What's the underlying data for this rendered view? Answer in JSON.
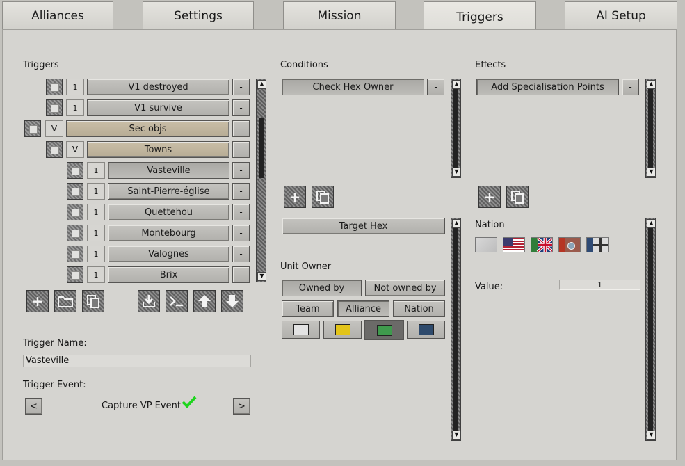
{
  "tabs": [
    "Alliances",
    "Settings",
    "Mission",
    "Triggers",
    "AI Setup"
  ],
  "triggers": {
    "header": "Triggers",
    "rows": [
      {
        "num": "1",
        "label": "V1 destroyed"
      },
      {
        "num": "1",
        "label": "V1 survive"
      },
      {
        "num": "V",
        "label": "Sec objs"
      },
      {
        "num": "V",
        "label": "Towns"
      },
      {
        "num": "1",
        "label": "Vasteville"
      },
      {
        "num": "1",
        "label": "Saint-Pierre-église"
      },
      {
        "num": "1",
        "label": "Quettehou"
      },
      {
        "num": "1",
        "label": "Montebourg"
      },
      {
        "num": "1",
        "label": "Valognes"
      },
      {
        "num": "1",
        "label": "Brix"
      }
    ],
    "minus": "-",
    "name_label": "Trigger Name:",
    "name_value": "Vasteville",
    "event_label": "Trigger Event:",
    "event_value": "Capture VP Event",
    "prev": "<",
    "next": ">"
  },
  "conditions": {
    "header": "Conditions",
    "item": "Check Hex Owner",
    "minus": "-",
    "target_hex": "Target Hex",
    "unit_owner_label": "Unit Owner",
    "owned_by": "Owned by",
    "not_owned_by": "Not owned by",
    "team": "Team",
    "alliance": "Alliance",
    "nation": "Nation",
    "swatch_colors": [
      "#e3e3e3",
      "#e3c419",
      "#3f9a4d",
      "#2e4a6c"
    ]
  },
  "effects": {
    "header": "Effects",
    "item": "Add Specialisation Points",
    "minus": "-",
    "nation_label": "Nation",
    "value_label": "Value:",
    "value": "1"
  },
  "colors": {
    "check_green": "#1ed51e",
    "tan_button": "#c1b69f"
  }
}
